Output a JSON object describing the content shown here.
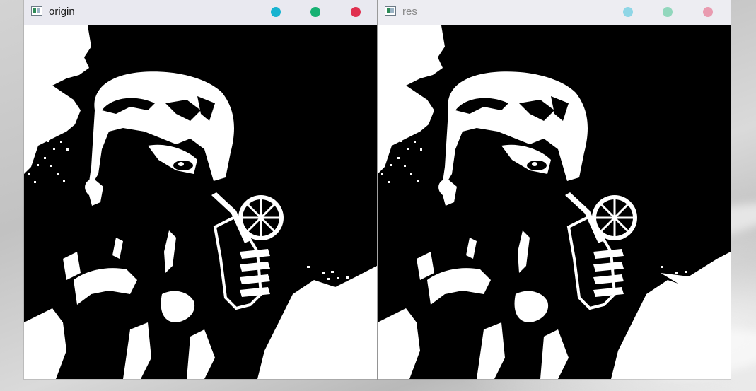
{
  "windows": [
    {
      "title": "origin",
      "state": "active",
      "controls": [
        {
          "name": "minimize-button",
          "color": "#17b3d0"
        },
        {
          "name": "maximize-button",
          "color": "#17b173"
        },
        {
          "name": "close-button",
          "color": "#e0304f"
        }
      ],
      "image": "binarized-anime-girl-drinking-lemonade"
    },
    {
      "title": "res",
      "state": "inactive",
      "controls": [
        {
          "name": "minimize-button",
          "color": "#8fd6e6"
        },
        {
          "name": "maximize-button",
          "color": "#92d7bd"
        },
        {
          "name": "close-button",
          "color": "#e99bb0"
        }
      ],
      "image": "binarized-anime-girl-drinking-lemonade-processed"
    }
  ],
  "icons": {
    "app": "opencv-window-icon"
  }
}
